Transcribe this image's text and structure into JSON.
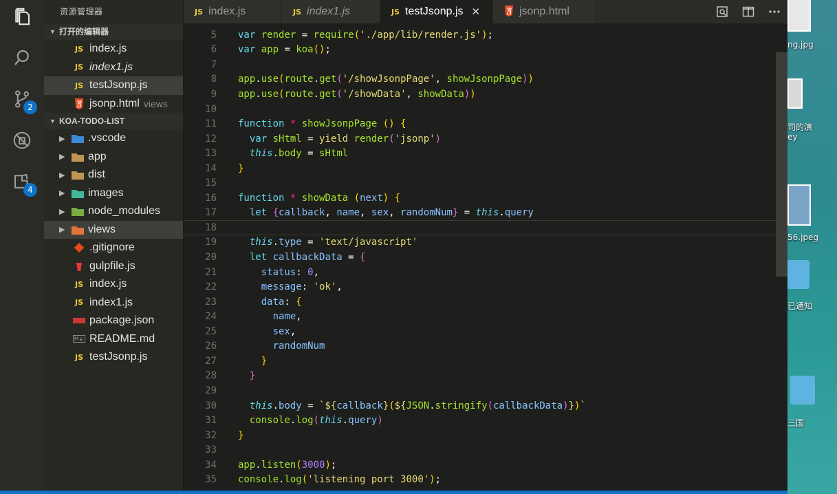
{
  "activity": [
    {
      "name": "files-icon"
    },
    {
      "name": "search-icon"
    },
    {
      "name": "source-control-icon",
      "badge": "2"
    },
    {
      "name": "debug-icon"
    },
    {
      "name": "extensions-icon",
      "badge": "4"
    }
  ],
  "sidebar": {
    "title": "资源管理器",
    "open_editors_header": "打开的编辑器",
    "open_editors": [
      {
        "icon": "JS",
        "label": "index.js",
        "italic": false,
        "desc": ""
      },
      {
        "icon": "JS",
        "label": "index1.js",
        "italic": true,
        "desc": ""
      },
      {
        "icon": "JS",
        "label": "testJsonp.js",
        "italic": false,
        "desc": "",
        "selected": true
      },
      {
        "icon": "html5-icon",
        "label": "jsonp.html",
        "italic": false,
        "desc": "views"
      }
    ],
    "project_header": "KOA-TODO-LIST",
    "tree": [
      {
        "type": "folder",
        "label": ".vscode",
        "icon": "vscode-folder-icon"
      },
      {
        "type": "folder",
        "label": "app",
        "icon": "folder-icon"
      },
      {
        "type": "folder",
        "label": "dist",
        "icon": "folder-icon"
      },
      {
        "type": "folder",
        "label": "images",
        "icon": "images-folder-icon"
      },
      {
        "type": "folder",
        "label": "node_modules",
        "icon": "node-folder-icon"
      },
      {
        "type": "folder",
        "label": "views",
        "icon": "views-folder-icon",
        "selected": true
      },
      {
        "type": "file",
        "label": ".gitignore",
        "icon": "git-icon"
      },
      {
        "type": "file",
        "label": "gulpfile.js",
        "icon": "gulp-icon"
      },
      {
        "type": "file",
        "label": "index.js",
        "icon": "JS"
      },
      {
        "type": "file",
        "label": "index1.js",
        "icon": "JS"
      },
      {
        "type": "file",
        "label": "package.json",
        "icon": "npm-icon"
      },
      {
        "type": "file",
        "label": "README.md",
        "icon": "markdown-icon"
      },
      {
        "type": "file",
        "label": "testJsonp.js",
        "icon": "JS"
      }
    ]
  },
  "tabs": [
    {
      "icon": "JS",
      "label": "index.js",
      "italic": false,
      "active": false
    },
    {
      "icon": "JS",
      "label": "index1.js",
      "italic": true,
      "active": false
    },
    {
      "icon": "JS",
      "label": "testJsonp.js",
      "italic": false,
      "active": true
    },
    {
      "icon": "html5-icon",
      "label": "jsonp.html",
      "italic": false,
      "active": false
    }
  ],
  "editor": {
    "cursor_line": 18,
    "lines": [
      {
        "n": "5",
        "tokens": [
          [
            "k",
            "var"
          ],
          [
            "p",
            " "
          ],
          [
            "ident",
            "render"
          ],
          [
            "p",
            " = "
          ],
          [
            "f",
            "require"
          ],
          [
            "bracket1",
            "("
          ],
          [
            "s",
            "'./app/lib/render.js'"
          ],
          [
            "bracket1",
            ")"
          ],
          [
            "p",
            ";"
          ]
        ]
      },
      {
        "n": "6",
        "tokens": [
          [
            "k",
            "var"
          ],
          [
            "p",
            " "
          ],
          [
            "ident",
            "app"
          ],
          [
            "p",
            " = "
          ],
          [
            "f",
            "koa"
          ],
          [
            "bracket1",
            "()"
          ],
          [
            "p",
            ";"
          ]
        ]
      },
      {
        "n": "7",
        "tokens": []
      },
      {
        "n": "8",
        "tokens": [
          [
            "f",
            "app"
          ],
          [
            "p",
            "."
          ],
          [
            "f",
            "use"
          ],
          [
            "bracket1",
            "("
          ],
          [
            "f",
            "route"
          ],
          [
            "p",
            "."
          ],
          [
            "f",
            "get"
          ],
          [
            "bracket2",
            "("
          ],
          [
            "s",
            "'/showJsonpPage'"
          ],
          [
            "p",
            ", "
          ],
          [
            "f",
            "showJsonpPage"
          ],
          [
            "bracket2",
            ")"
          ],
          [
            "bracket1",
            ")"
          ]
        ]
      },
      {
        "n": "9",
        "tokens": [
          [
            "f",
            "app"
          ],
          [
            "p",
            "."
          ],
          [
            "f",
            "use"
          ],
          [
            "bracket1",
            "("
          ],
          [
            "f",
            "route"
          ],
          [
            "p",
            "."
          ],
          [
            "f",
            "get"
          ],
          [
            "bracket2",
            "("
          ],
          [
            "s",
            "'/showData'"
          ],
          [
            "p",
            ", "
          ],
          [
            "f",
            "showData"
          ],
          [
            "bracket2",
            ")"
          ],
          [
            "bracket1",
            ")"
          ]
        ]
      },
      {
        "n": "10",
        "tokens": []
      },
      {
        "n": "11",
        "tokens": [
          [
            "k",
            "function"
          ],
          [
            "p",
            " "
          ],
          [
            "y",
            "*"
          ],
          [
            "p",
            " "
          ],
          [
            "f",
            "showJsonpPage"
          ],
          [
            "p",
            " "
          ],
          [
            "bracket1",
            "()"
          ],
          [
            "p",
            " "
          ],
          [
            "bracket1",
            "{"
          ]
        ]
      },
      {
        "n": "12",
        "tokens": [
          [
            "p",
            "  "
          ],
          [
            "k",
            "var"
          ],
          [
            "p",
            " "
          ],
          [
            "ident",
            "sHtml"
          ],
          [
            "p",
            " = "
          ],
          [
            "s",
            "yield"
          ],
          [
            "p",
            " "
          ],
          [
            "f",
            "render"
          ],
          [
            "bracket2",
            "("
          ],
          [
            "s",
            "'jsonp'"
          ],
          [
            "bracket2",
            ")"
          ]
        ]
      },
      {
        "n": "13",
        "tokens": [
          [
            "p",
            "  "
          ],
          [
            "t",
            "this"
          ],
          [
            "p",
            "."
          ],
          [
            "ident",
            "body"
          ],
          [
            "p",
            " = "
          ],
          [
            "ident",
            "sHtml"
          ]
        ]
      },
      {
        "n": "14",
        "tokens": [
          [
            "bracket1",
            "}"
          ]
        ]
      },
      {
        "n": "15",
        "tokens": []
      },
      {
        "n": "16",
        "tokens": [
          [
            "k",
            "function"
          ],
          [
            "p",
            " "
          ],
          [
            "y",
            "*"
          ],
          [
            "p",
            " "
          ],
          [
            "f",
            "showData"
          ],
          [
            "p",
            " "
          ],
          [
            "bracket1",
            "("
          ],
          [
            "pv",
            "next"
          ],
          [
            "bracket1",
            ")"
          ],
          [
            "p",
            " "
          ],
          [
            "bracket1",
            "{"
          ]
        ]
      },
      {
        "n": "17",
        "tokens": [
          [
            "p",
            "  "
          ],
          [
            "k",
            "let"
          ],
          [
            "p",
            " "
          ],
          [
            "bracket2",
            "{"
          ],
          [
            "pv",
            "callback"
          ],
          [
            "p",
            ", "
          ],
          [
            "pv",
            "name"
          ],
          [
            "p",
            ", "
          ],
          [
            "pv",
            "sex"
          ],
          [
            "p",
            ", "
          ],
          [
            "pv",
            "randomNum"
          ],
          [
            "bracket2",
            "}"
          ],
          [
            "p",
            " = "
          ],
          [
            "t",
            "this"
          ],
          [
            "p",
            "."
          ],
          [
            "pv",
            "query"
          ]
        ]
      },
      {
        "n": "18",
        "tokens": []
      },
      {
        "n": "19",
        "tokens": [
          [
            "p",
            "  "
          ],
          [
            "t",
            "this"
          ],
          [
            "p",
            "."
          ],
          [
            "pv",
            "type"
          ],
          [
            "p",
            " = "
          ],
          [
            "s",
            "'text/javascript'"
          ]
        ]
      },
      {
        "n": "20",
        "tokens": [
          [
            "p",
            "  "
          ],
          [
            "k",
            "let"
          ],
          [
            "p",
            " "
          ],
          [
            "pv",
            "callbackData"
          ],
          [
            "p",
            " = "
          ],
          [
            "bracket2",
            "{"
          ]
        ]
      },
      {
        "n": "21",
        "tokens": [
          [
            "p",
            "    "
          ],
          [
            "pv",
            "status"
          ],
          [
            "p",
            ": "
          ],
          [
            "n",
            "0"
          ],
          [
            "p",
            ","
          ]
        ]
      },
      {
        "n": "22",
        "tokens": [
          [
            "p",
            "    "
          ],
          [
            "pv",
            "message"
          ],
          [
            "p",
            ": "
          ],
          [
            "s",
            "'ok'"
          ],
          [
            "p",
            ","
          ]
        ]
      },
      {
        "n": "23",
        "tokens": [
          [
            "p",
            "    "
          ],
          [
            "pv",
            "data"
          ],
          [
            "p",
            ": "
          ],
          [
            "bracket1",
            "{"
          ]
        ]
      },
      {
        "n": "24",
        "tokens": [
          [
            "p",
            "      "
          ],
          [
            "pv",
            "name"
          ],
          [
            "p",
            ","
          ]
        ]
      },
      {
        "n": "25",
        "tokens": [
          [
            "p",
            "      "
          ],
          [
            "pv",
            "sex"
          ],
          [
            "p",
            ","
          ]
        ]
      },
      {
        "n": "26",
        "tokens": [
          [
            "p",
            "      "
          ],
          [
            "pv",
            "randomNum"
          ]
        ]
      },
      {
        "n": "27",
        "tokens": [
          [
            "p",
            "    "
          ],
          [
            "bracket1",
            "}"
          ]
        ]
      },
      {
        "n": "28",
        "tokens": [
          [
            "p",
            "  "
          ],
          [
            "bracket2",
            "}"
          ]
        ]
      },
      {
        "n": "29",
        "tokens": []
      },
      {
        "n": "30",
        "tokens": [
          [
            "p",
            "  "
          ],
          [
            "t",
            "this"
          ],
          [
            "p",
            "."
          ],
          [
            "pv",
            "body"
          ],
          [
            "p",
            " = "
          ],
          [
            "s",
            "`${"
          ],
          [
            "pv",
            "callback"
          ],
          [
            "s",
            "}"
          ],
          [
            "bracket1",
            "("
          ],
          [
            "s",
            "${"
          ],
          [
            "f",
            "JSON"
          ],
          [
            "p",
            "."
          ],
          [
            "f",
            "stringify"
          ],
          [
            "bracket2",
            "("
          ],
          [
            "pv",
            "callbackData"
          ],
          [
            "bracket2",
            ")"
          ],
          [
            "s",
            "}"
          ],
          [
            "bracket1",
            ")"
          ],
          [
            "s",
            "`"
          ]
        ]
      },
      {
        "n": "31",
        "tokens": [
          [
            "p",
            "  "
          ],
          [
            "f",
            "console"
          ],
          [
            "p",
            "."
          ],
          [
            "f",
            "log"
          ],
          [
            "bracket2",
            "("
          ],
          [
            "t",
            "this"
          ],
          [
            "p",
            "."
          ],
          [
            "pv",
            "query"
          ],
          [
            "bracket2",
            ")"
          ]
        ]
      },
      {
        "n": "32",
        "tokens": [
          [
            "bracket1",
            "}"
          ]
        ]
      },
      {
        "n": "33",
        "tokens": []
      },
      {
        "n": "34",
        "tokens": [
          [
            "f",
            "app"
          ],
          [
            "p",
            "."
          ],
          [
            "f",
            "listen"
          ],
          [
            "bracket1",
            "("
          ],
          [
            "n",
            "3000"
          ],
          [
            "bracket1",
            ")"
          ],
          [
            "p",
            ";"
          ]
        ]
      },
      {
        "n": "35",
        "tokens": [
          [
            "f",
            "console"
          ],
          [
            "p",
            "."
          ],
          [
            "f",
            "log"
          ],
          [
            "bracket1",
            "("
          ],
          [
            "s",
            "'listening port 3000'"
          ],
          [
            "bracket1",
            ")"
          ],
          [
            "p",
            ";"
          ]
        ]
      }
    ]
  },
  "desktop": {
    "labels": [
      "ng.jpg",
      "司的演",
      "ey",
      "56.jpeg",
      "已通知",
      "三国"
    ]
  },
  "colors": {
    "accent": "#0e73c8",
    "js_icon": "#e8c73e"
  }
}
